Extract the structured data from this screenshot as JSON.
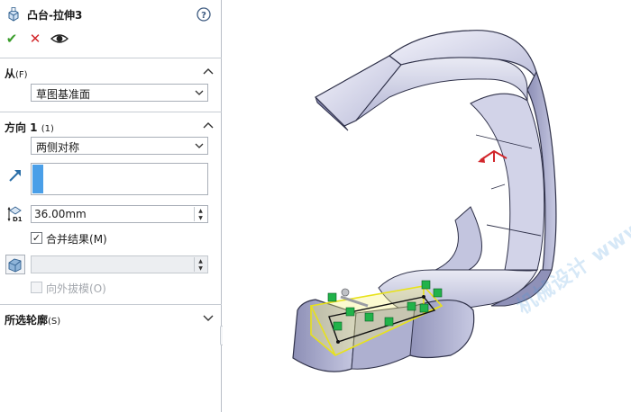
{
  "property_manager": {
    "title": "凸台-拉伸3",
    "actions": {
      "ok": "✔",
      "cancel": "✕"
    },
    "from_section": {
      "label": "从",
      "accel": "(F)",
      "selected": "草图基准面"
    },
    "direction1_section": {
      "label": "方向 1",
      "accel": "(1)",
      "end_condition": "两侧对称",
      "depth_value": "36.00mm",
      "merge_result_label": "合并结果",
      "merge_result_accel": "(M)",
      "merge_result_checked": true,
      "draft_value": "",
      "draft_outward_label": "向外拔模",
      "draft_outward_accel": "(O)",
      "draft_outward_checked": false
    },
    "selected_contours_section": {
      "label": "所选轮廓",
      "accel": "(S)"
    }
  },
  "viewport": {
    "watermark": "机械设计 www.jxage.com",
    "model_color": "#9ea0c6",
    "highlight_color": "#f0ec3a",
    "handle_color": "#21b34a"
  },
  "colors": {
    "accent_blue": "#4a9fe8",
    "ok_green": "#3a9d2b",
    "cancel_red": "#d2262b"
  }
}
